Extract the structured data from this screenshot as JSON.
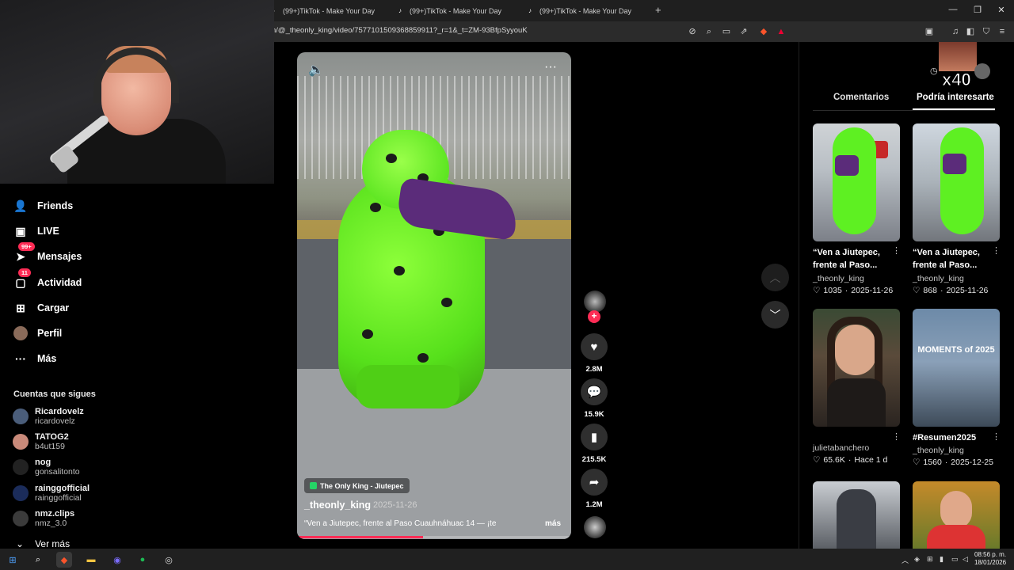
{
  "browser": {
    "tabs": [
      {
        "title": "(99+)TikTok - Make Your Day"
      },
      {
        "title": "(99+)TikTok - Make Your Day"
      },
      {
        "title": "(99+)TikTok - Make Your Day"
      }
    ],
    "new_tab": "+",
    "url": "n/@_theonly_king/video/7577101509368859911?_r=1&_t=ZM-93BfpSyyouK",
    "window_controls": [
      "minimize-icon",
      "restore-icon",
      "close-icon"
    ]
  },
  "sidebar": {
    "items": [
      {
        "label": "Friends",
        "icon": "friends-icon"
      },
      {
        "label": "LIVE",
        "icon": "live-icon"
      },
      {
        "label": "Mensajes",
        "icon": "messages-icon",
        "badge": "99+"
      },
      {
        "label": "Actividad",
        "icon": "activity-icon",
        "badge": "11"
      },
      {
        "label": "Cargar",
        "icon": "upload-icon"
      },
      {
        "label": "Perfil",
        "icon": "profile-icon"
      },
      {
        "label": "Más",
        "icon": "more-icon"
      }
    ],
    "following_title": "Cuentas que sigues",
    "following": [
      {
        "name": "Ricardovelz",
        "handle": "ricardovelz",
        "color": "#4a5d7a"
      },
      {
        "name": "TATOG2",
        "handle": "b4ut159",
        "color": "#c98a7a"
      },
      {
        "name": "nog",
        "handle": "gonsalitonto",
        "color": "#222222"
      },
      {
        "name": "rainggofficial",
        "handle": "rainggofficial",
        "color": "#1b2c5a"
      },
      {
        "name": "nmz.clips",
        "handle": "nmz_3.0",
        "color": "#3b3b3b"
      }
    ],
    "see_more": "Ver más"
  },
  "video": {
    "location": "The Only King - Jiutepec",
    "author": "_theonly_king",
    "date": "2025-11-26",
    "caption": "“Ven a Jiutepec, frente al Paso Cuauhnáhuac 14 — ¡te",
    "more": "más",
    "progress": 0.46
  },
  "actions": [
    {
      "icon": "heart-icon",
      "count": "2.8M"
    },
    {
      "icon": "comment-icon",
      "count": "15.9K"
    },
    {
      "icon": "bookmark-icon",
      "count": "215.5K"
    },
    {
      "icon": "share-icon",
      "count": "1.2M"
    }
  ],
  "right_panel": {
    "overlay_text": "x40",
    "tabs": [
      "Comentarios",
      "Podría interesarte"
    ],
    "active_tab": 1,
    "cards": [
      {
        "title": "“Ven a Jiutepec, frente al Paso...",
        "user": "_theonly_king",
        "likes": "1035",
        "date": "2025-11-26"
      },
      {
        "title": "“Ven a Jiutepec, frente al Paso...",
        "user": "_theonly_king",
        "likes": "868",
        "date": "2025-11-26"
      },
      {
        "title": "",
        "user": "julietabanchero",
        "likes": "65.6K",
        "date": "Hace 1 d"
      },
      {
        "title": "#Resumen2025",
        "user": "_theonly_king",
        "likes": "1560",
        "date": "2025-12-25",
        "thumb_text": "MOMENTS of 2025"
      }
    ]
  },
  "taskbar": {
    "time": "08:56 p. m.",
    "date": "18/01/2026"
  }
}
